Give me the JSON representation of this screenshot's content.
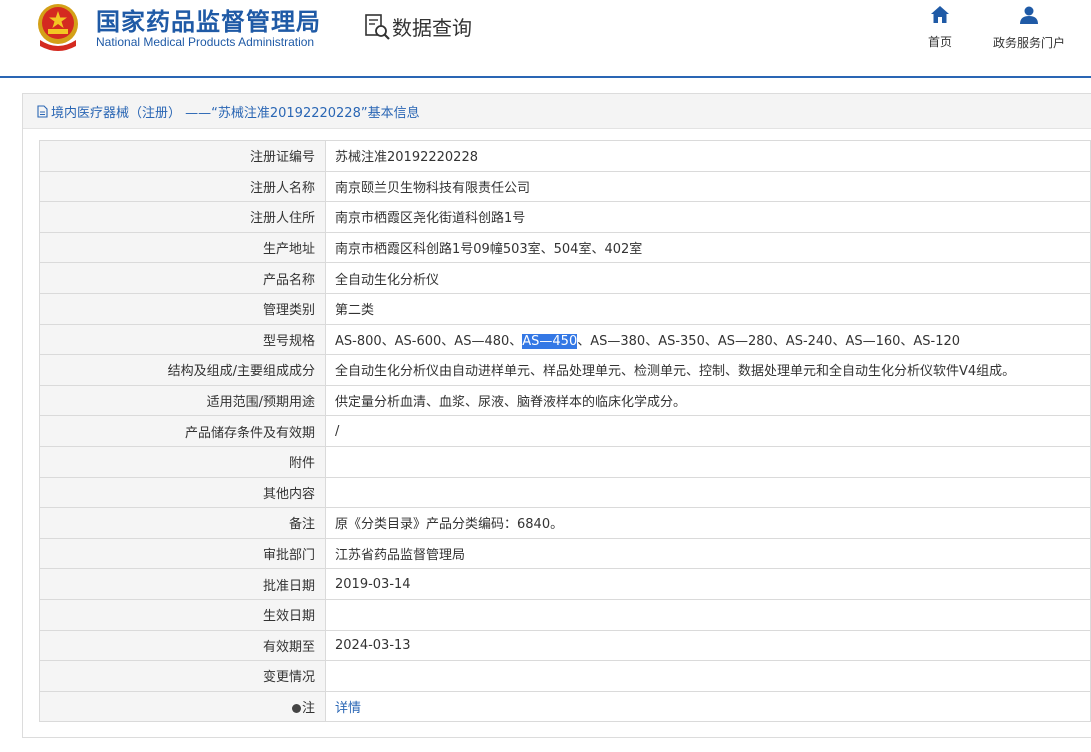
{
  "header": {
    "title": "国家药品监督管理局",
    "subtitle": "National Medical Products Administration",
    "query_title": "数据查询",
    "nav": [
      {
        "label": "首页",
        "icon": "home-icon"
      },
      {
        "label": "政务服务门户",
        "icon": "user-icon"
      }
    ]
  },
  "panel": {
    "title": "境内医疗器械（注册） ——“苏械注准20192220228”基本信息",
    "icon": "document-icon"
  },
  "fields": {
    "reg_no": {
      "label": "注册证编号",
      "value": "苏械注准20192220228"
    },
    "registrant": {
      "label": "注册人名称",
      "value": "南京颐兰贝生物科技有限责任公司"
    },
    "registrant_addr": {
      "label": "注册人住所",
      "value": "南京市栖霞区尧化街道科创路1号"
    },
    "production_addr": {
      "label": "生产地址",
      "value": "南京市栖霞区科创路1号09幢503室、504室、402室"
    },
    "product_name": {
      "label": "产品名称",
      "value": "全自动生化分析仪"
    },
    "category": {
      "label": "管理类别",
      "value": "第二类"
    },
    "models": {
      "label": "型号规格",
      "before": "AS-800、AS-600、AS—480、",
      "selected": "AS—450",
      "after": "、AS—380、AS-350、AS—280、AS-240、AS—160、AS-120"
    },
    "structure": {
      "label": "结构及组成/主要组成成分",
      "value": "全自动生化分析仪由自动进样单元、样品处理单元、检测单元、控制、数据处理单元和全自动生化分析仪软件V4组成。"
    },
    "usage": {
      "label": "适用范围/预期用途",
      "value": "供定量分析血清、血浆、尿液、脑脊液样本的临床化学成分。"
    },
    "storage": {
      "label": "产品储存条件及有效期",
      "value": "/"
    },
    "attachment": {
      "label": "附件",
      "value": ""
    },
    "other": {
      "label": "其他内容",
      "value": ""
    },
    "remark": {
      "label": "备注",
      "value": "原《分类目录》产品分类编码：6840。"
    },
    "approval_dept": {
      "label": "审批部门",
      "value": "江苏省药品监督管理局"
    },
    "approval_date": {
      "label": "批准日期",
      "value": "2019-03-14"
    },
    "effective_date": {
      "label": "生效日期",
      "value": ""
    },
    "expiry_date": {
      "label": "有效期至",
      "value": "2024-03-13"
    },
    "changes": {
      "label": "变更情况",
      "value": ""
    },
    "note": {
      "label": "注",
      "link": "详情"
    }
  }
}
